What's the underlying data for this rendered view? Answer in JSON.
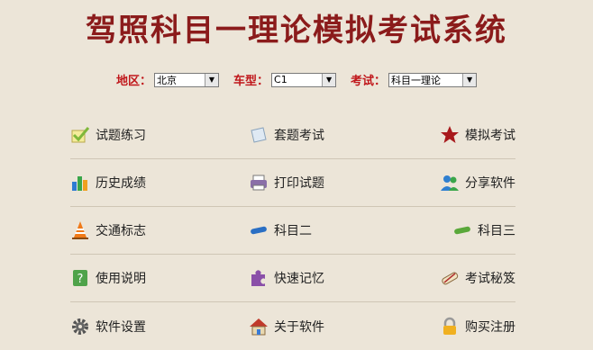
{
  "title": "驾照科目一理论模拟考试系统",
  "filters": {
    "region_label": "地区",
    "region_value": "北京",
    "car_label": "车型",
    "car_value": "C1",
    "exam_label": "考试",
    "exam_value": "科目一理论"
  },
  "menu": [
    {
      "label": "试题练习",
      "icon": "check-icon"
    },
    {
      "label": "套题考试",
      "icon": "paper-icon"
    },
    {
      "label": "模拟考试",
      "icon": "star-icon"
    },
    {
      "label": "历史成绩",
      "icon": "bar-chart-icon"
    },
    {
      "label": "打印试题",
      "icon": "printer-icon"
    },
    {
      "label": "分享软件",
      "icon": "users-icon"
    },
    {
      "label": "交通标志",
      "icon": "traffic-cone-icon"
    },
    {
      "label": "科目二",
      "icon": "blue-stick-icon"
    },
    {
      "label": "科目三",
      "icon": "green-stick-icon"
    },
    {
      "label": "使用说明",
      "icon": "help-icon"
    },
    {
      "label": "快速记忆",
      "icon": "puzzle-icon"
    },
    {
      "label": "考试秘笈",
      "icon": "scroll-icon"
    },
    {
      "label": "软件设置",
      "icon": "gear-icon"
    },
    {
      "label": "关于软件",
      "icon": "house-icon"
    },
    {
      "label": "购买注册",
      "icon": "lock-icon"
    }
  ]
}
